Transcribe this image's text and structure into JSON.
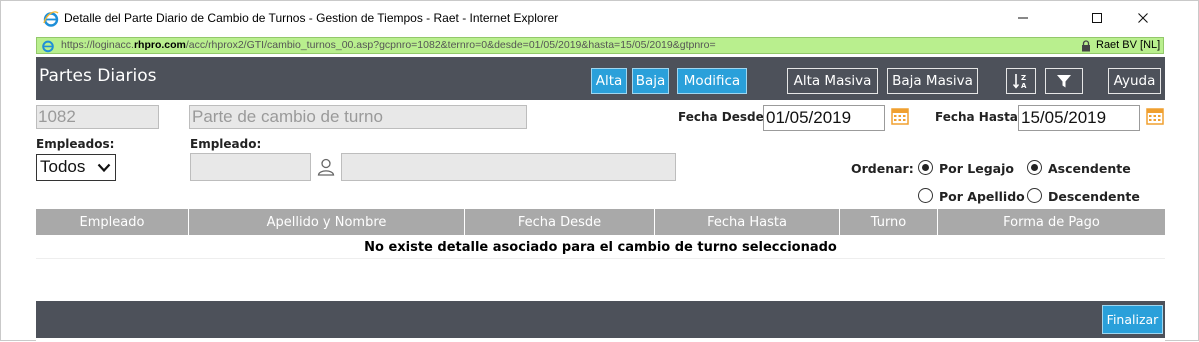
{
  "window": {
    "title": "Detalle del Parte Diario de Cambio de Turnos - Gestion de Tiempos - Raet - Internet Explorer",
    "controls": {
      "minimize": "—",
      "maximize": "☐",
      "close": "✕"
    }
  },
  "address_bar": {
    "url_prefix": "https://loginacc.",
    "url_domain": "rhpro.com",
    "url_rest": "/acc/rhprox2/GTI/cambio_turnos_00.asp?gcpnro=1082&ternro=0&desde=01/05/2019&hasta=15/05/2019&gtpnro=",
    "certificate": "Raet BV [NL]"
  },
  "header": {
    "title": "Partes Diarios",
    "buttons": {
      "alta": "Alta",
      "baja": "Baja",
      "modifica": "Modifica",
      "alta_masiva": "Alta Masiva",
      "baja_masiva": "Baja Masiva",
      "ayuda": "Ayuda"
    },
    "icons": {
      "sort": "sort-az-icon",
      "filter": "filter-icon"
    }
  },
  "form": {
    "code": "1082",
    "description": "Parte de cambio de turno",
    "fecha_desde_label": "Fecha Desde:",
    "fecha_desde_value": "01/05/2019",
    "fecha_hasta_label": "Fecha Hasta:",
    "fecha_hasta_value": "15/05/2019",
    "empleados_label": "Empleados:",
    "empleados_selected": "Todos",
    "empleado_label": "Empleado:",
    "empleado_code": "",
    "empleado_name": "",
    "ordenar_label": "Ordenar:",
    "order_by": [
      {
        "label": "Por Legajo",
        "checked": true
      },
      {
        "label": "Por Apellido",
        "checked": false
      }
    ],
    "direction": [
      {
        "label": "Ascendente",
        "checked": true
      },
      {
        "label": "Descendente",
        "checked": false
      }
    ]
  },
  "table": {
    "columns": [
      "Empleado",
      "Apellido y Nombre",
      "Fecha Desde",
      "Fecha Hasta",
      "Turno",
      "Forma de Pago"
    ],
    "empty_message": "No existe detalle asociado para el cambio de turno seleccionado"
  },
  "footer": {
    "finalizar": "Finalizar"
  },
  "colors": {
    "header_bg": "#4d515a",
    "accent_blue": "#2aa0da",
    "address_green": "#b9ef8e",
    "table_head": "#a9a9a9",
    "calendar_orange": "#f0a030"
  }
}
